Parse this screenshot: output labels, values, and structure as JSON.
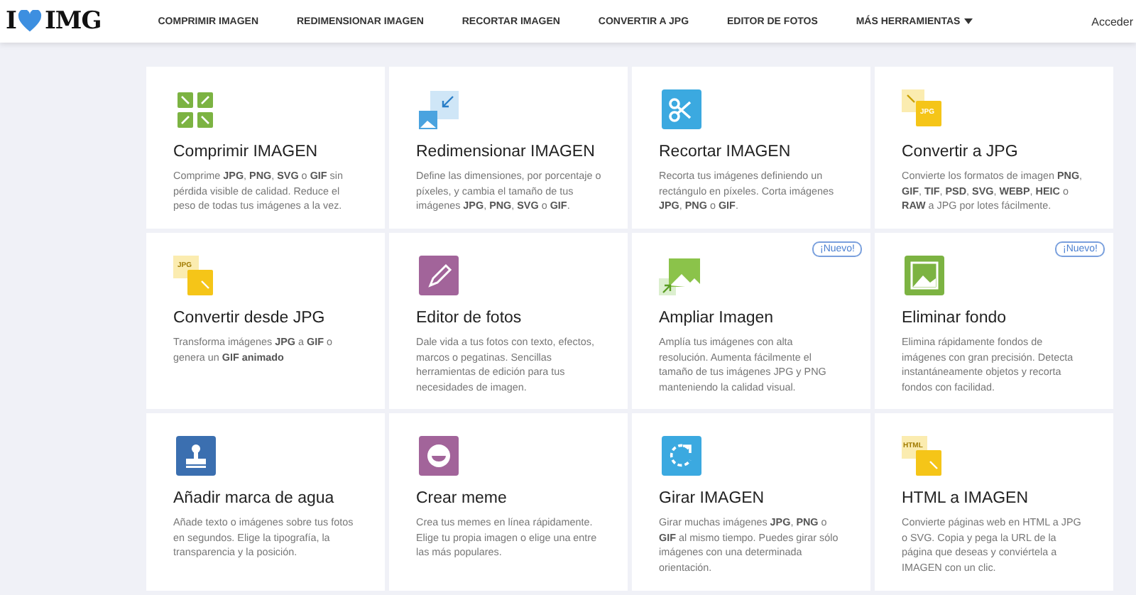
{
  "header": {
    "logo": {
      "left": "I",
      "right": "IMG"
    },
    "nav": [
      {
        "label": "COMPRIMIR IMAGEN",
        "dropdown": false
      },
      {
        "label": "REDIMENSIONAR IMAGEN",
        "dropdown": false
      },
      {
        "label": "RECORTAR IMAGEN",
        "dropdown": false
      },
      {
        "label": "CONVERTIR A JPG",
        "dropdown": false
      },
      {
        "label": "EDITOR DE FOTOS",
        "dropdown": false
      },
      {
        "label": "MÁS HERRAMIENTAS",
        "dropdown": true
      }
    ],
    "login": "Acceder"
  },
  "tools": [
    {
      "kind": "compress",
      "title": "Comprimir IMAGEN",
      "description": "Comprime **JPG**, **PNG**, **SVG** o **GIF** sin pérdida visible de calidad. Reduce el peso de todas tus imágenes a la vez."
    },
    {
      "kind": "resize",
      "title": "Redimensionar IMAGEN",
      "description": "Define las dimensiones, por porcentaje o píxeles, y cambia el tamaño de tus imágenes **JPG**, **PNG**, **SVG** o **GIF**."
    },
    {
      "kind": "crop",
      "title": "Recortar IMAGEN",
      "description": "Recorta tus imágenes definiendo un rectángulo en píxeles. Corta imágenes **JPG**, **PNG** o **GIF**."
    },
    {
      "kind": "to-jpg",
      "icon_label": "JPG",
      "title": "Convertir a JPG",
      "description": "Convierte los formatos de imagen **PNG**, **GIF**, **TIF**, **PSD**, **SVG**, **WEBP**, **HEIC** o **RAW** a JPG por lotes fácilmente."
    },
    {
      "kind": "from-jpg",
      "icon_label": "JPG",
      "title": "Convertir desde JPG",
      "description": "Transforma imágenes **JPG** a **GIF** o genera un **GIF animado**"
    },
    {
      "kind": "edit",
      "title": "Editor de fotos",
      "description": "Dale vida a tus fotos con texto, efectos, marcos o pegatinas. Sencillas herramientas de edición para tus necesidades de imagen."
    },
    {
      "kind": "upscale",
      "badge": "¡Nuevo!",
      "title": "Ampliar Imagen",
      "description": "Amplía tus imágenes con alta resolución. Aumenta fácilmente el tamaño de tus imágenes JPG y PNG manteniendo la calidad visual."
    },
    {
      "kind": "remove-bg",
      "badge": "¡Nuevo!",
      "title": "Eliminar fondo",
      "description": "Elimina rápidamente fondos de imágenes con gran precisión. Detecta instantáneamente objetos y recorta fondos con facilidad."
    },
    {
      "kind": "watermark",
      "title": "Añadir marca de agua",
      "description": "Añade texto o imágenes sobre tus fotos en segundos. Elige la tipografía, la transparencia y la posición."
    },
    {
      "kind": "meme",
      "title": "Crear meme",
      "description": "Crea tus memes en línea rápidamente. Elige tu propia imagen o elige una entre las más populares."
    },
    {
      "kind": "rotate",
      "title": "Girar IMAGEN",
      "description": "Girar muchas imágenes **JPG**, **PNG** o **GIF** al mismo tiempo. Puedes girar sólo imágenes con una determinada orientación."
    },
    {
      "kind": "html",
      "icon_label": "HTML",
      "title": "HTML a IMAGEN",
      "description": "Convierte páginas web en HTML a JPG o SVG. Copia y pega la URL de la página que deseas y conviértela a IMAGEN con un clic."
    }
  ]
}
